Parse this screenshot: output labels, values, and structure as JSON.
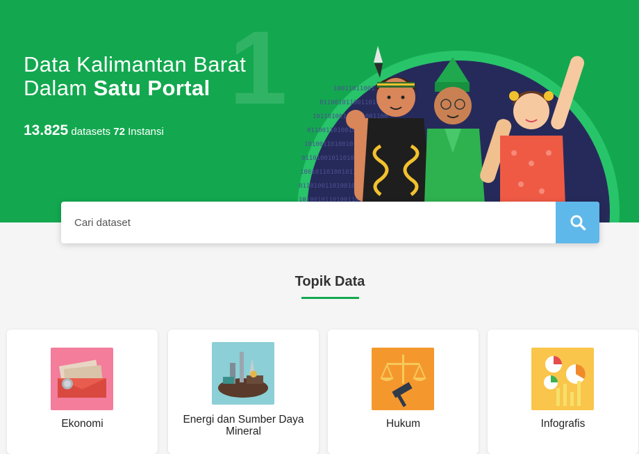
{
  "hero": {
    "title_line1": "Data Kalimantan Barat",
    "title_line2_prefix": "Dalam ",
    "title_line2_bold": "Satu Portal",
    "watermark_digit": "1",
    "dataset_count": "13.825",
    "dataset_label": " datasets ",
    "instansi_count": "72",
    "instansi_label": " Instansi"
  },
  "search": {
    "placeholder": "Cari dataset",
    "button_icon": "search-icon",
    "button_color": "#5fb8ea"
  },
  "topics": {
    "title": "Topik Data",
    "accent_color": "#13a84f",
    "items": [
      {
        "label": "Ekonomi",
        "icon": "money-envelope-icon"
      },
      {
        "label": "Energi dan Sumber Daya Mineral",
        "icon": "energy-mining-icon"
      },
      {
        "label": "Hukum",
        "icon": "scales-gavel-icon"
      },
      {
        "label": "Infografis",
        "icon": "infographic-icon"
      }
    ]
  }
}
